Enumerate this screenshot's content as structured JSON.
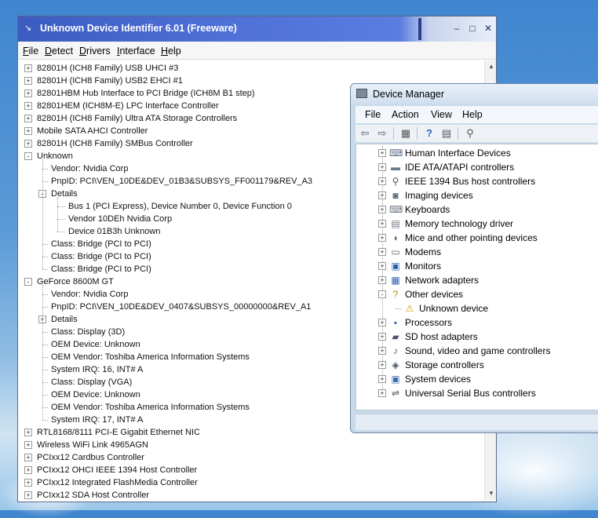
{
  "udi": {
    "title": "Unknown Device Identifier 6.01 (Freeware)",
    "menu": [
      {
        "key": "F",
        "rest": "ile"
      },
      {
        "key": "D",
        "rest": "etect"
      },
      {
        "key": "D",
        "rest": "rivers"
      },
      {
        "key": "I",
        "rest": "nterface"
      },
      {
        "key": "H",
        "rest": "elp"
      }
    ],
    "rows": [
      {
        "text": "82801H (ICH8 Family) USB UHCI #3",
        "level": 0,
        "expander": "+"
      },
      {
        "text": "82801H (ICH8 Family) USB2 EHCI #1",
        "level": 0,
        "expander": "+"
      },
      {
        "text": "82801HBM Hub Interface to PCI Bridge (ICH8M B1 step)",
        "level": 0,
        "expander": "+"
      },
      {
        "text": "82801HEM (ICH8M-E) LPC Interface Controller",
        "level": 0,
        "expander": "+"
      },
      {
        "text": "82801H (ICH8 Family) Ultra ATA Storage Controllers",
        "level": 0,
        "expander": "+"
      },
      {
        "text": "Mobile SATA AHCI Controller",
        "level": 0,
        "expander": "+"
      },
      {
        "text": "82801H (ICH8 Family) SMBus Controller",
        "level": 0,
        "expander": "+"
      },
      {
        "text": "Unknown",
        "level": 0,
        "expander": "-"
      },
      {
        "text": "Vendor: Nvidia Corp",
        "level": 1,
        "expander": ""
      },
      {
        "text": "PnpID: PCI\\VEN_10DE&DEV_01B3&SUBSYS_FF001179&REV_A3",
        "level": 1,
        "expander": ""
      },
      {
        "text": "Details",
        "level": 1,
        "expander": "-"
      },
      {
        "text": "Bus 1 (PCI Express), Device Number 0, Device Function 0",
        "level": 2,
        "expander": ""
      },
      {
        "text": "Vendor 10DEh Nvidia Corp",
        "level": 2,
        "expander": ""
      },
      {
        "text": "Device 01B3h Unknown",
        "level": 2,
        "expander": ""
      },
      {
        "text": "Class: Bridge (PCI to PCI)",
        "level": 1,
        "expander": ""
      },
      {
        "text": "Class: Bridge (PCI to PCI)",
        "level": 1,
        "expander": ""
      },
      {
        "text": "Class: Bridge (PCI to PCI)",
        "level": 1,
        "expander": ""
      },
      {
        "text": "GeForce 8600M GT",
        "level": 0,
        "expander": "-"
      },
      {
        "text": "Vendor: Nvidia Corp",
        "level": 1,
        "expander": ""
      },
      {
        "text": "PnpID: PCI\\VEN_10DE&DEV_0407&SUBSYS_00000000&REV_A1",
        "level": 1,
        "expander": ""
      },
      {
        "text": "Details",
        "level": 1,
        "expander": "+"
      },
      {
        "text": "Class: Display (3D)",
        "level": 1,
        "expander": ""
      },
      {
        "text": "OEM Device: Unknown",
        "level": 1,
        "expander": ""
      },
      {
        "text": "OEM Vendor: Toshiba America Information Systems",
        "level": 1,
        "expander": ""
      },
      {
        "text": "System IRQ: 16, INT# A",
        "level": 1,
        "expander": ""
      },
      {
        "text": "Class: Display (VGA)",
        "level": 1,
        "expander": ""
      },
      {
        "text": "OEM Device: Unknown",
        "level": 1,
        "expander": ""
      },
      {
        "text": "OEM Vendor: Toshiba America Information Systems",
        "level": 1,
        "expander": ""
      },
      {
        "text": "System IRQ: 17, INT# A",
        "level": 1,
        "expander": ""
      },
      {
        "text": "RTL8168/8111 PCI-E Gigabit Ethernet NIC",
        "level": 0,
        "expander": "+"
      },
      {
        "text": "Wireless WiFi Link 4965AGN",
        "level": 0,
        "expander": "+"
      },
      {
        "text": "PCIxx12 Cardbus Controller",
        "level": 0,
        "expander": "+"
      },
      {
        "text": "PCIxx12 OHCI IEEE 1394 Host Controller",
        "level": 0,
        "expander": "+"
      },
      {
        "text": "PCIxx12 Integrated FlashMedia Controller",
        "level": 0,
        "expander": "+"
      },
      {
        "text": "PCIxx12 SDA Host Controller",
        "level": 0,
        "expander": "+"
      }
    ]
  },
  "dm": {
    "title": "Device Manager",
    "menu": [
      "File",
      "Action",
      "View",
      "Help"
    ],
    "rows": [
      {
        "text": "Human Interface Devices",
        "level": 0,
        "expander": "+",
        "icon": "hid-icon",
        "glyph": "⌨",
        "color": "#5a6f88"
      },
      {
        "text": "IDE ATA/ATAPI controllers",
        "level": 0,
        "expander": "+",
        "icon": "ide-controller-icon",
        "glyph": "▬",
        "color": "#6b7a8c"
      },
      {
        "text": "IEEE 1394 Bus host controllers",
        "level": 0,
        "expander": "+",
        "icon": "firewire-icon",
        "glyph": "⚲",
        "color": "#4a5566"
      },
      {
        "text": "Imaging devices",
        "level": 0,
        "expander": "+",
        "icon": "camera-icon",
        "glyph": "◙",
        "color": "#55606d"
      },
      {
        "text": "Keyboards",
        "level": 0,
        "expander": "+",
        "icon": "keyboard-icon",
        "glyph": "⌨",
        "color": "#6a7482"
      },
      {
        "text": "Memory technology driver",
        "level": 0,
        "expander": "+",
        "icon": "memory-icon",
        "glyph": "▤",
        "color": "#6a7482"
      },
      {
        "text": "Mice and other pointing devices",
        "level": 0,
        "expander": "+",
        "icon": "mouse-icon",
        "glyph": "◖",
        "color": "#5a6470"
      },
      {
        "text": "Modems",
        "level": 0,
        "expander": "+",
        "icon": "modem-icon",
        "glyph": "▭",
        "color": "#5a6470"
      },
      {
        "text": "Monitors",
        "level": 0,
        "expander": "+",
        "icon": "monitor-icon",
        "glyph": "▣",
        "color": "#2a5fb0"
      },
      {
        "text": "Network adapters",
        "level": 0,
        "expander": "+",
        "icon": "network-icon",
        "glyph": "▦",
        "color": "#2a5fb0"
      },
      {
        "text": "Other devices",
        "level": 0,
        "expander": "-",
        "icon": "unknown-device-icon",
        "glyph": "?",
        "color": "#b08a00"
      },
      {
        "text": "Unknown device",
        "level": 1,
        "expander": "",
        "icon": "warning-icon",
        "glyph": "⚠",
        "color": "#d4a000"
      },
      {
        "text": "Processors",
        "level": 0,
        "expander": "+",
        "icon": "processor-icon",
        "glyph": "▪",
        "color": "#3a6ab0"
      },
      {
        "text": "SD host adapters",
        "level": 0,
        "expander": "+",
        "icon": "sd-card-icon",
        "glyph": "▰",
        "color": "#4a5566"
      },
      {
        "text": "Sound, video and game controllers",
        "level": 0,
        "expander": "+",
        "icon": "sound-icon",
        "glyph": "♪",
        "color": "#4a5566"
      },
      {
        "text": "Storage controllers",
        "level": 0,
        "expander": "+",
        "icon": "storage-icon",
        "glyph": "◈",
        "color": "#4a5566"
      },
      {
        "text": "System devices",
        "level": 0,
        "expander": "+",
        "icon": "system-device-icon",
        "glyph": "▣",
        "color": "#3a6ab0"
      },
      {
        "text": "Universal Serial Bus controllers",
        "level": 0,
        "expander": "+",
        "icon": "usb-icon",
        "glyph": "⇌",
        "color": "#4a5566"
      }
    ]
  }
}
